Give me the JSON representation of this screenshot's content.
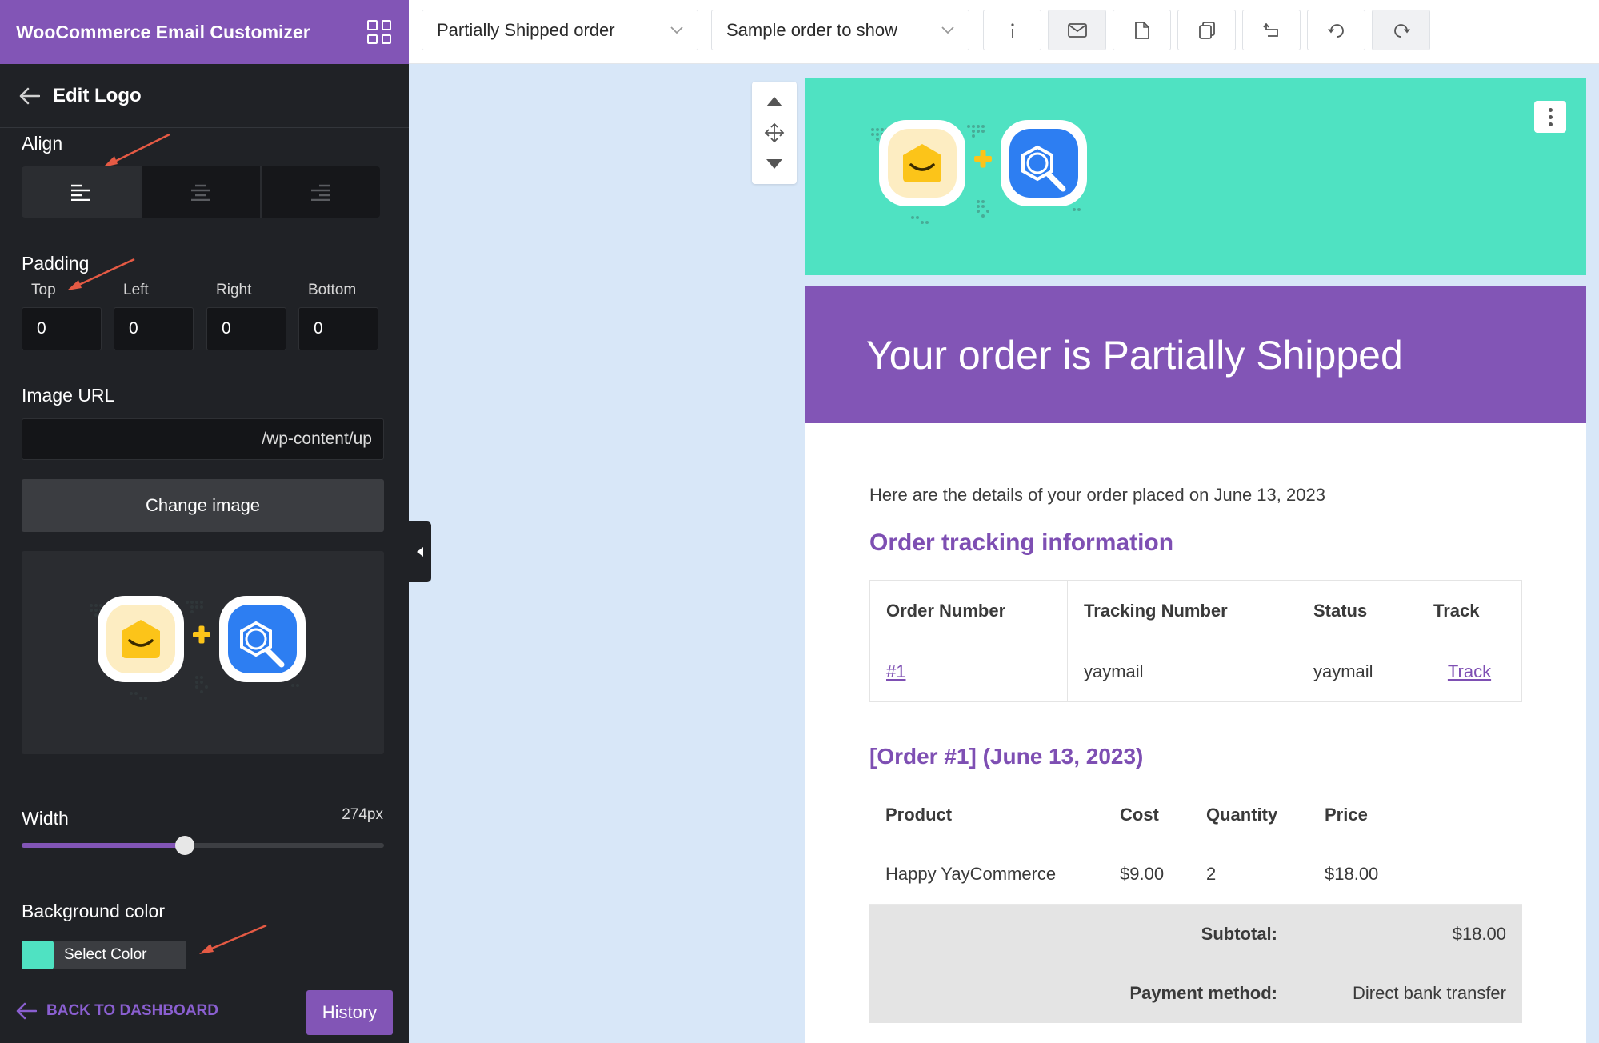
{
  "app": {
    "title": "WooCommerce Email Customizer"
  },
  "editor": {
    "title": "Edit Logo",
    "align": {
      "label": "Align",
      "selected": "left"
    },
    "padding": {
      "label": "Padding",
      "fields": [
        {
          "label": "Top",
          "value": "0"
        },
        {
          "label": "Left",
          "value": "0"
        },
        {
          "label": "Right",
          "value": "0"
        },
        {
          "label": "Bottom",
          "value": "0"
        }
      ]
    },
    "image_url": {
      "label": "Image URL",
      "value": "/wp-content/up"
    },
    "change_image_label": "Change image",
    "width": {
      "label": "Width",
      "value_text": "274px",
      "fill_fraction": 0.45
    },
    "background": {
      "label": "Background color",
      "button_label": "Select Color",
      "color": "#4fe2c2"
    },
    "back_label": "BACK TO DASHBOARD",
    "history_label": "History"
  },
  "toolbar": {
    "email_type": "Partially Shipped order",
    "sample_order": "Sample order to show",
    "buttons": [
      "info-icon",
      "mail-icon",
      "document-icon",
      "copy-icon",
      "undo-icon",
      "reset-icon",
      "redo-icon"
    ]
  },
  "email": {
    "logo_bg": "#4fe2c2",
    "header_bg": "#8255b6",
    "heading": "Your order is Partially Shipped",
    "intro": "Here are the details of your order placed on June 13, 2023",
    "tracking": {
      "title": "Order tracking information",
      "headers": [
        "Order Number",
        "Tracking Number",
        "Status",
        "Track"
      ],
      "row": {
        "order": "#1",
        "tracking": "yaymail",
        "status": "yaymail",
        "track": "Track"
      }
    },
    "order": {
      "title": "[Order #1] (June 13, 2023)",
      "headers": [
        "Product",
        "Cost",
        "Quantity",
        "Price"
      ],
      "row": {
        "product": "Happy YayCommerce",
        "cost": "$9.00",
        "qty": "2",
        "price": "$18.00"
      },
      "subtotal_label": "Subtotal:",
      "subtotal_value": "$18.00",
      "payment_label": "Payment method:",
      "payment_value": "Direct bank transfer"
    }
  },
  "colors": {
    "accent": "#8255b6",
    "sidebar": "#202226",
    "annotation": "#e55a44",
    "link_purple": "#7e4fb3"
  }
}
